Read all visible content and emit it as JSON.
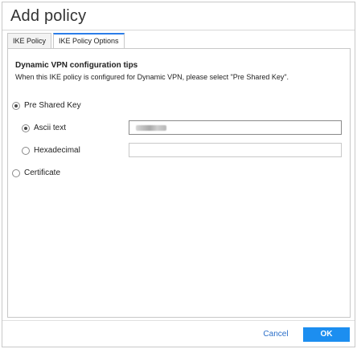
{
  "dialog": {
    "title": "Add policy",
    "tabs": [
      {
        "label": "IKE Policy",
        "active": false
      },
      {
        "label": "IKE Policy Options",
        "active": true
      }
    ]
  },
  "tips": {
    "title": "Dynamic VPN configuration tips",
    "text": "When this IKE policy is configured for Dynamic VPN, please select \"Pre Shared Key\"."
  },
  "auth_options": {
    "pre_shared_key": {
      "label": "Pre Shared Key",
      "selected": true
    },
    "certificate": {
      "label": "Certificate",
      "selected": false
    }
  },
  "key_format": {
    "ascii": {
      "label": "Ascii text",
      "selected": true,
      "value": "••••••••"
    },
    "hex": {
      "label": "Hexadecimal",
      "selected": false,
      "value": ""
    }
  },
  "footer": {
    "cancel_label": "Cancel",
    "ok_label": "OK"
  },
  "colors": {
    "accent": "#1c8ef0",
    "link": "#2b6fc9",
    "border": "#c8c8c8"
  }
}
